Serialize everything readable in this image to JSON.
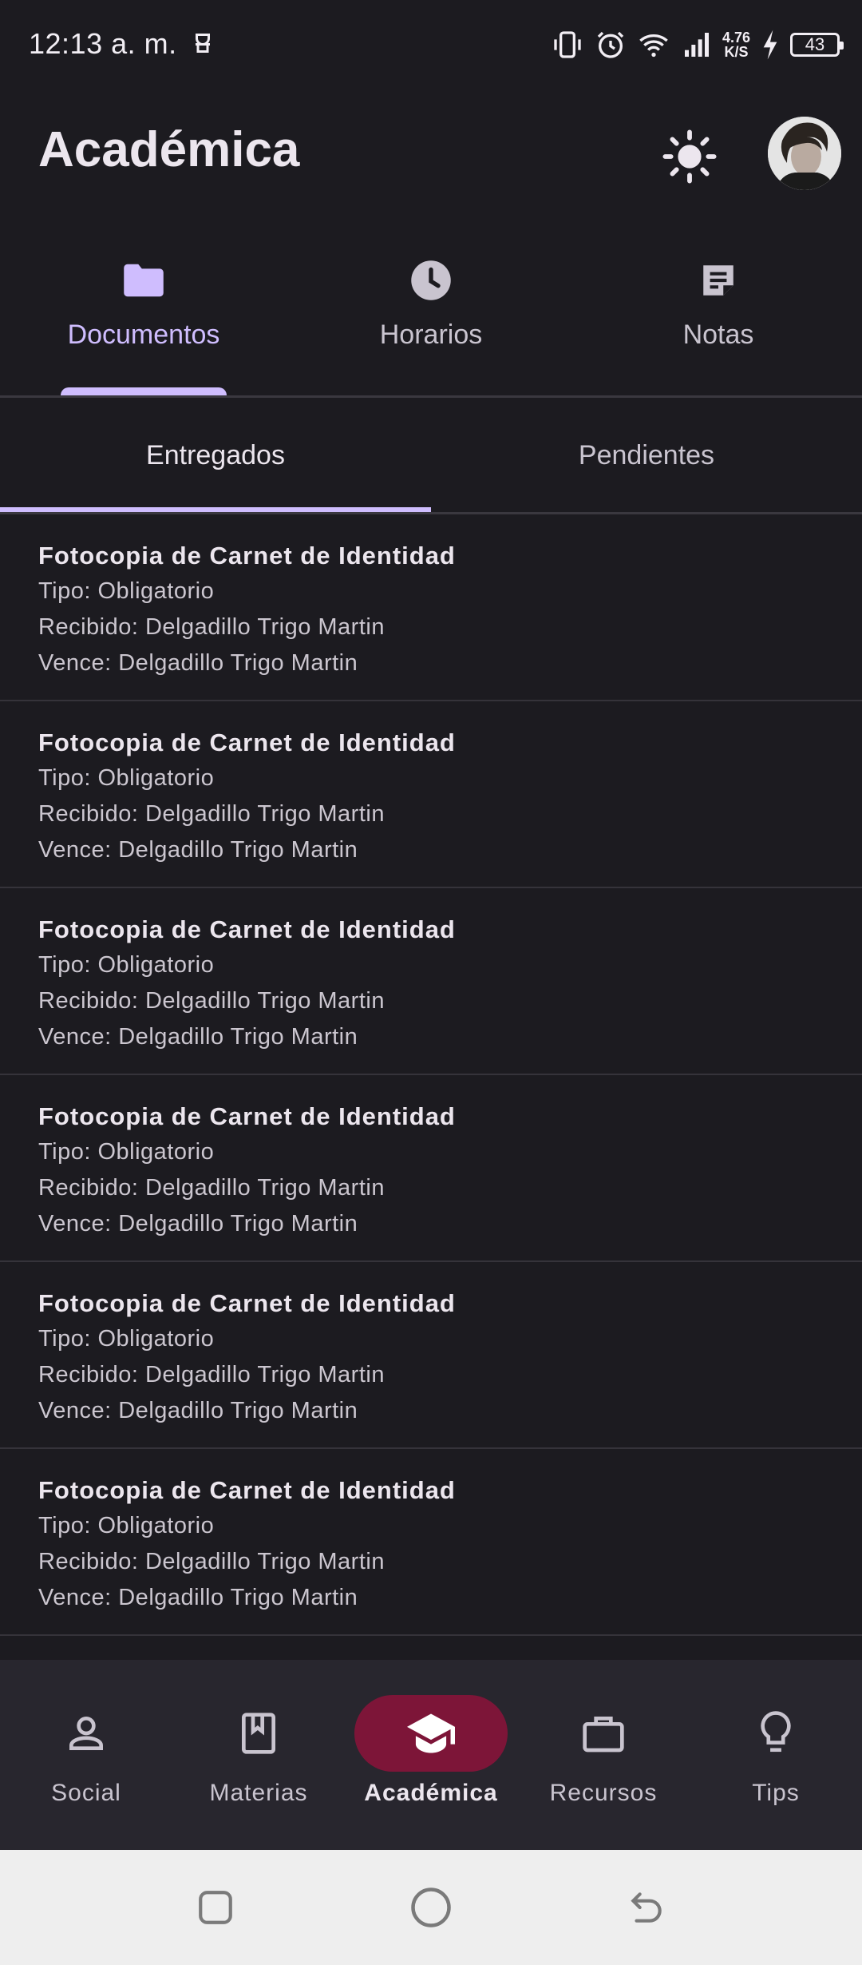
{
  "status_bar": {
    "time": "12:13 a. m.",
    "net_speed_value": "4.76",
    "net_speed_unit": "K/S",
    "battery_level": "43"
  },
  "header": {
    "title": "Académica"
  },
  "top_tabs": [
    {
      "label": "Documentos",
      "icon": "folder-icon",
      "active": true
    },
    {
      "label": "Horarios",
      "icon": "clock-icon",
      "active": false
    },
    {
      "label": "Notas",
      "icon": "note-icon",
      "active": false
    }
  ],
  "sub_tabs": [
    {
      "label": "Entregados",
      "active": true
    },
    {
      "label": "Pendientes",
      "active": false
    }
  ],
  "documents": [
    {
      "title": "Fotocopia de Carnet de Identidad",
      "tipo": "Tipo: Obligatorio",
      "recibido": "Recibido: Delgadillo Trigo Martin",
      "vence": "Vence: Delgadillo Trigo Martin"
    },
    {
      "title": "Fotocopia de Carnet de Identidad",
      "tipo": "Tipo: Obligatorio",
      "recibido": "Recibido: Delgadillo Trigo Martin",
      "vence": "Vence: Delgadillo Trigo Martin"
    },
    {
      "title": "Fotocopia de Carnet de Identidad",
      "tipo": "Tipo: Obligatorio",
      "recibido": "Recibido: Delgadillo Trigo Martin",
      "vence": "Vence: Delgadillo Trigo Martin"
    },
    {
      "title": "Fotocopia de Carnet de Identidad",
      "tipo": "Tipo: Obligatorio",
      "recibido": "Recibido: Delgadillo Trigo Martin",
      "vence": "Vence: Delgadillo Trigo Martin"
    },
    {
      "title": "Fotocopia de Carnet de Identidad",
      "tipo": "Tipo: Obligatorio",
      "recibido": "Recibido: Delgadillo Trigo Martin",
      "vence": "Vence: Delgadillo Trigo Martin"
    },
    {
      "title": "Fotocopia de Carnet de Identidad",
      "tipo": "Tipo: Obligatorio",
      "recibido": "Recibido: Delgadillo Trigo Martin",
      "vence": "Vence: Delgadillo Trigo Martin"
    }
  ],
  "bottom_nav": [
    {
      "label": "Social",
      "icon": "person-icon",
      "active": false
    },
    {
      "label": "Materias",
      "icon": "book-icon",
      "active": false
    },
    {
      "label": "Académica",
      "icon": "graduation-cap-icon",
      "active": true
    },
    {
      "label": "Recursos",
      "icon": "briefcase-icon",
      "active": false
    },
    {
      "label": "Tips",
      "icon": "lightbulb-icon",
      "active": false
    }
  ],
  "colors": {
    "background": "#1c1b20",
    "accent": "#cfbdfe",
    "active_nav_pill": "#7d1538",
    "bottom_nav_bg": "#28262e"
  }
}
